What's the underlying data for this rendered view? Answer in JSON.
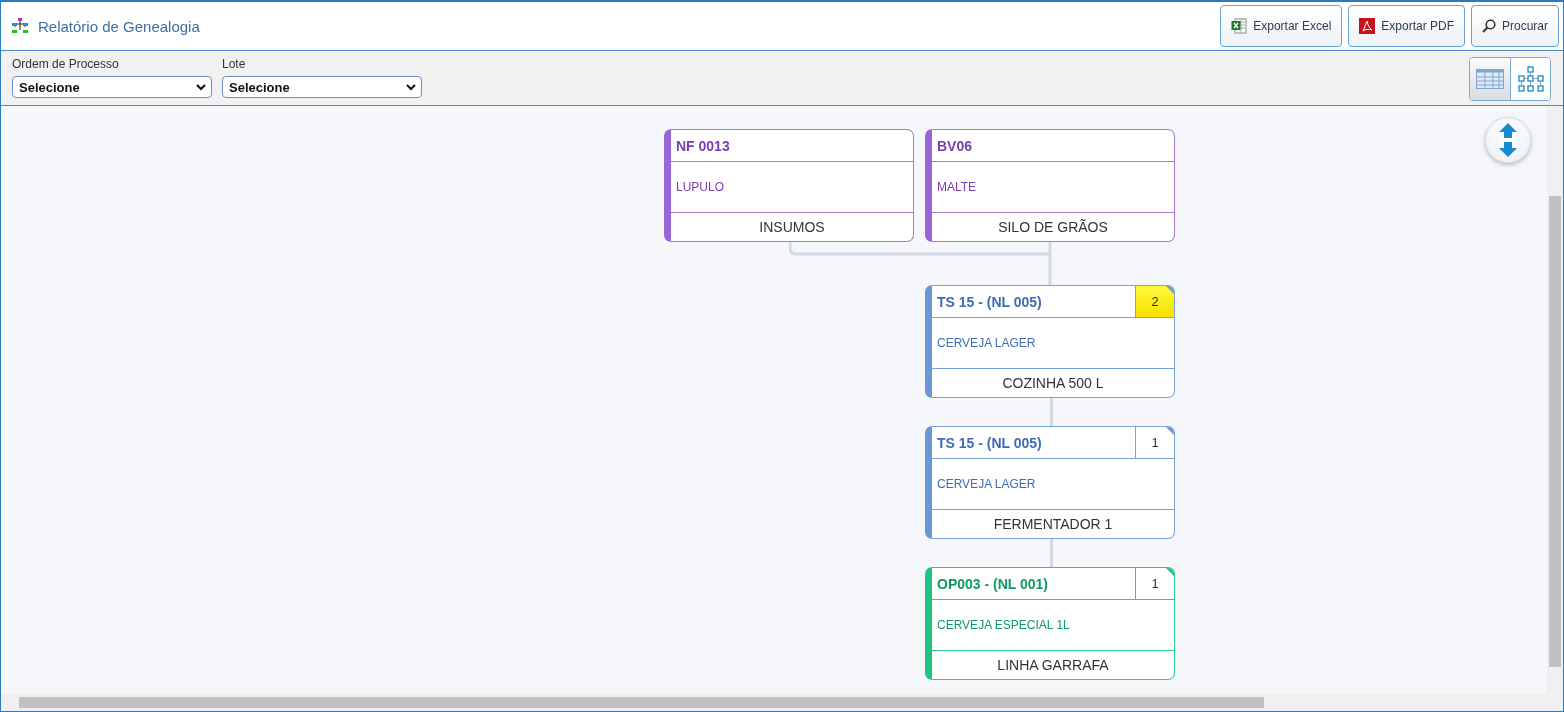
{
  "header": {
    "title": "Relatório de Genealogia",
    "buttons": [
      {
        "kind": "excel",
        "label": "Exportar Excel"
      },
      {
        "kind": "pdf",
        "label": "Exportar PDF"
      },
      {
        "kind": "search",
        "label": "Procurar"
      }
    ]
  },
  "filters": [
    {
      "label": "Ordem de Processo",
      "value": "Selecione"
    },
    {
      "label": "Lote",
      "value": "Selecione"
    }
  ],
  "view_toggle": [
    {
      "kind": "table",
      "selected": true
    },
    {
      "kind": "tree",
      "selected": false
    }
  ],
  "inputs": [
    {
      "kind": "input",
      "code": "NF 0013",
      "product": "LUPULO",
      "place": "INSUMOS"
    },
    {
      "kind": "input",
      "code": "BV06",
      "product": "MALTE",
      "place": "SILO DE GRÃOS"
    }
  ],
  "chain": [
    {
      "kind": "process",
      "code": "TS 15 - (NL 005)",
      "count": "2",
      "highlighted": true,
      "product": "CERVEJA LAGER",
      "place": "COZINHA 500 L"
    },
    {
      "kind": "process",
      "code": "TS 15 - (NL 005)",
      "count": "1",
      "highlighted": false,
      "product": "CERVEJA LAGER",
      "place": "FERMENTADOR 1"
    },
    {
      "kind": "output",
      "code": "OP003 - (NL 001)",
      "count": "1",
      "highlighted": false,
      "product": "CERVEJA ESPECIAL 1L",
      "place": "LINHA GARRAFA"
    }
  ]
}
